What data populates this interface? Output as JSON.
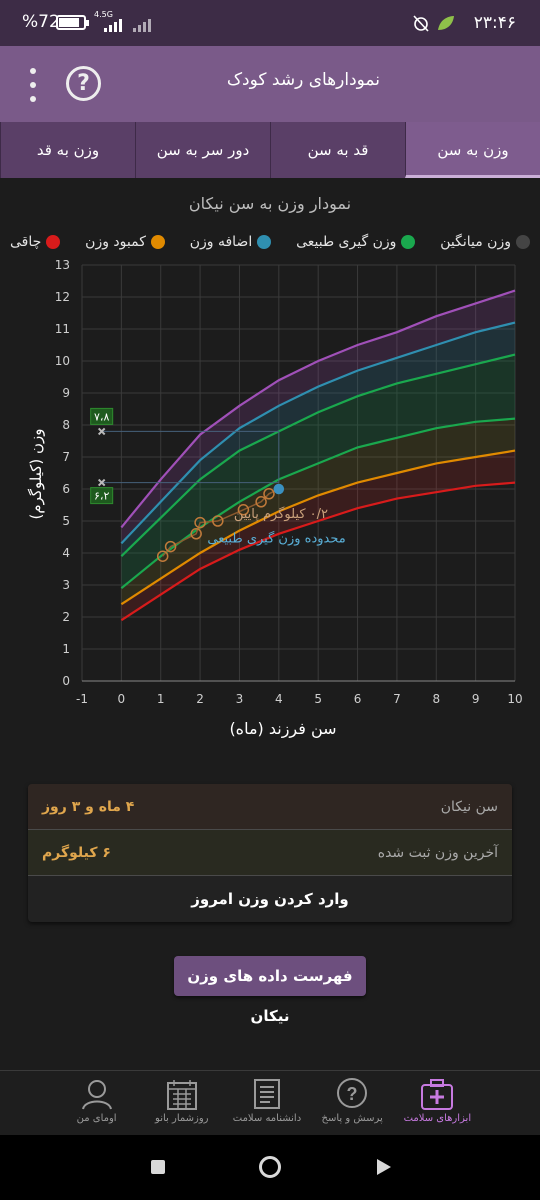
{
  "status_bar": {
    "time": "۲۳:۴۶",
    "battery_percent": "%72",
    "network_label": "4.5G"
  },
  "app_bar": {
    "title": "نمودارهای رشد کودک",
    "help_icon": "question-circle-icon",
    "menu_icon": "more-vertical-icon"
  },
  "tabs": [
    {
      "label": "وزن به سن",
      "active": true
    },
    {
      "label": "قد به سن",
      "active": false
    },
    {
      "label": "دور سر به سن",
      "active": false
    },
    {
      "label": "وزن به قد",
      "active": false
    }
  ],
  "chart_title": "نمودار وزن به سن نیکان",
  "legend": [
    {
      "label": "چاقی",
      "color": "#d81b1b"
    },
    {
      "label": "کمبود وزن",
      "color": "#e08a00"
    },
    {
      "label": "اضافه وزن",
      "color": "#2f8fb0"
    },
    {
      "label": "وزن گیری طبیعی",
      "color": "#1aa84e"
    },
    {
      "label": "وزن میانگین",
      "color": "#444444"
    }
  ],
  "chart_data": {
    "type": "line",
    "xlabel": "سن فرزند (ماه)",
    "ylabel": "وزن (کیلوگرم)",
    "xlim": [
      -1,
      10
    ],
    "ylim": [
      0,
      13
    ],
    "x_ticks": [
      "-1",
      "0",
      "1",
      "2",
      "3",
      "4",
      "5",
      "6",
      "7",
      "8",
      "9",
      "10"
    ],
    "y_ticks": [
      "0",
      "1",
      "2",
      "3",
      "4",
      "5",
      "6",
      "7",
      "8",
      "9",
      "10",
      "11",
      "12",
      "13"
    ],
    "x": [
      0,
      1,
      2,
      3,
      4,
      5,
      6,
      7,
      8,
      9,
      10
    ],
    "series": [
      {
        "values": [
          1.9,
          2.7,
          3.5,
          4.1,
          4.6,
          5.0,
          5.4,
          5.7,
          5.9,
          6.1,
          6.2
        ],
        "color": "#d81b1b"
      },
      {
        "values": [
          2.4,
          3.2,
          4.0,
          4.7,
          5.3,
          5.8,
          6.2,
          6.5,
          6.8,
          7.0,
          7.2
        ],
        "color": "#e08a00"
      },
      {
        "values": [
          2.9,
          3.9,
          4.8,
          5.6,
          6.3,
          6.8,
          7.3,
          7.6,
          7.9,
          8.1,
          8.2
        ],
        "color": "#1aa84e"
      },
      {
        "values": [
          3.9,
          5.1,
          6.3,
          7.2,
          7.8,
          8.4,
          8.9,
          9.3,
          9.6,
          9.9,
          10.2
        ],
        "color": "#1aa84e"
      },
      {
        "values": [
          4.3,
          5.6,
          6.9,
          7.9,
          8.6,
          9.2,
          9.7,
          10.1,
          10.5,
          10.9,
          11.2
        ],
        "color": "#2f8fb0"
      },
      {
        "values": [
          4.8,
          6.3,
          7.7,
          8.6,
          9.4,
          10.0,
          10.5,
          10.9,
          11.4,
          11.8,
          12.2
        ],
        "color": "#a050b8"
      }
    ],
    "measurements": {
      "x": [
        1.05,
        1.25,
        1.9,
        2.0,
        2.45,
        3.1,
        3.55,
        3.75,
        4.0
      ],
      "y": [
        3.9,
        4.2,
        4.6,
        4.95,
        5.0,
        5.35,
        5.6,
        5.85,
        6.0
      ]
    },
    "reference": {
      "x": 4.0,
      "low": 6.2,
      "high": 7.8,
      "low_label": "۶،۲",
      "high_label": "۷،۸"
    },
    "annotations": [
      "۰/۲ کیلوگرم پایین",
      "محدوده وزن گیری طبیعی"
    ]
  },
  "info": {
    "age_label": "سن نیکان",
    "age_value": "۴ ماه و ۳ روز",
    "weight_label": "آخرین وزن ثبت شده",
    "weight_value": "۶ کیلوگرم",
    "action_label": "وارد کردن وزن امروز"
  },
  "list_button": "فهرست داده های وزن نیکان",
  "bottom_nav": [
    {
      "label": "ابزارهای سلامت",
      "icon": "health-kit-icon",
      "active": true
    },
    {
      "label": "پرسش و پاسخ",
      "icon": "question-bubble-icon",
      "active": false
    },
    {
      "label": "دانشنامه سلامت",
      "icon": "encyclopedia-icon",
      "active": false
    },
    {
      "label": "روزشمار بانو",
      "icon": "calendar-icon",
      "active": false
    },
    {
      "label": "اومای من",
      "icon": "user-avatar-icon",
      "active": false
    }
  ]
}
